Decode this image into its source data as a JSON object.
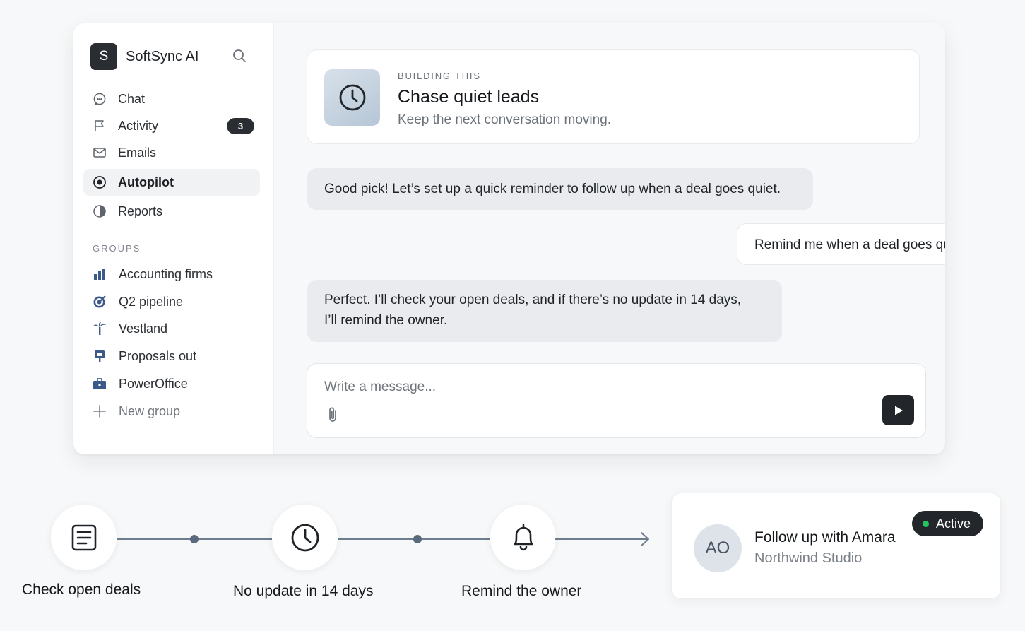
{
  "sidebar": {
    "logo_letter": "S",
    "app_name": "SoftSync AI",
    "nav": [
      {
        "label": "Chat",
        "icon": "chat-bubble-icon"
      },
      {
        "label": "Activity",
        "icon": "flag-icon",
        "badge": "3"
      },
      {
        "label": "Emails",
        "icon": "mail-icon"
      },
      {
        "label": "Autopilot",
        "icon": "target-icon",
        "active": true
      },
      {
        "label": "Reports",
        "icon": "pie-chart-icon"
      }
    ],
    "groups_heading": "GROUPS",
    "groups": [
      {
        "label": "Accounting firms",
        "icon": "bar-chart-icon"
      },
      {
        "label": "Q2 pipeline",
        "icon": "bullseye-icon"
      },
      {
        "label": "Vestland",
        "icon": "palm-tree-icon"
      },
      {
        "label": "Proposals out",
        "icon": "pushpin-icon"
      },
      {
        "label": "PowerOffice",
        "icon": "briefcase-icon"
      },
      {
        "label": "New group",
        "icon": "plus-icon"
      }
    ]
  },
  "header_card": {
    "eyebrow": "BUILDING THIS",
    "title": "Chase quiet leads",
    "subtitle": "Keep the next conversation moving.",
    "icon": "clock-icon"
  },
  "messages": [
    {
      "role": "assistant",
      "text": "Good pick! Let’s set up a quick reminder to follow up when a deal goes quiet."
    },
    {
      "role": "user",
      "text": "Remind me when a deal goes quiet."
    },
    {
      "role": "assistant",
      "line1": "Perfect. I’ll check your open deals, and if there’s no update in 14 days,",
      "line2": "I’ll remind the owner."
    }
  ],
  "composer": {
    "placeholder": "Write a message..."
  },
  "flow": {
    "steps": [
      {
        "label": "Check open deals",
        "icon": "document-icon"
      },
      {
        "label": "No update in 14 days",
        "icon": "clock-icon"
      },
      {
        "label": "Remind the owner",
        "icon": "bell-icon"
      }
    ]
  },
  "result": {
    "initials": "AO",
    "title": "Follow up with Amara",
    "subtitle": "Northwind Studio",
    "status": "Active",
    "status_color": "#22c55e"
  },
  "colors": {
    "dark": "#2a2d31",
    "connector": "#6e7d8e",
    "accent_green": "#22c55e"
  }
}
